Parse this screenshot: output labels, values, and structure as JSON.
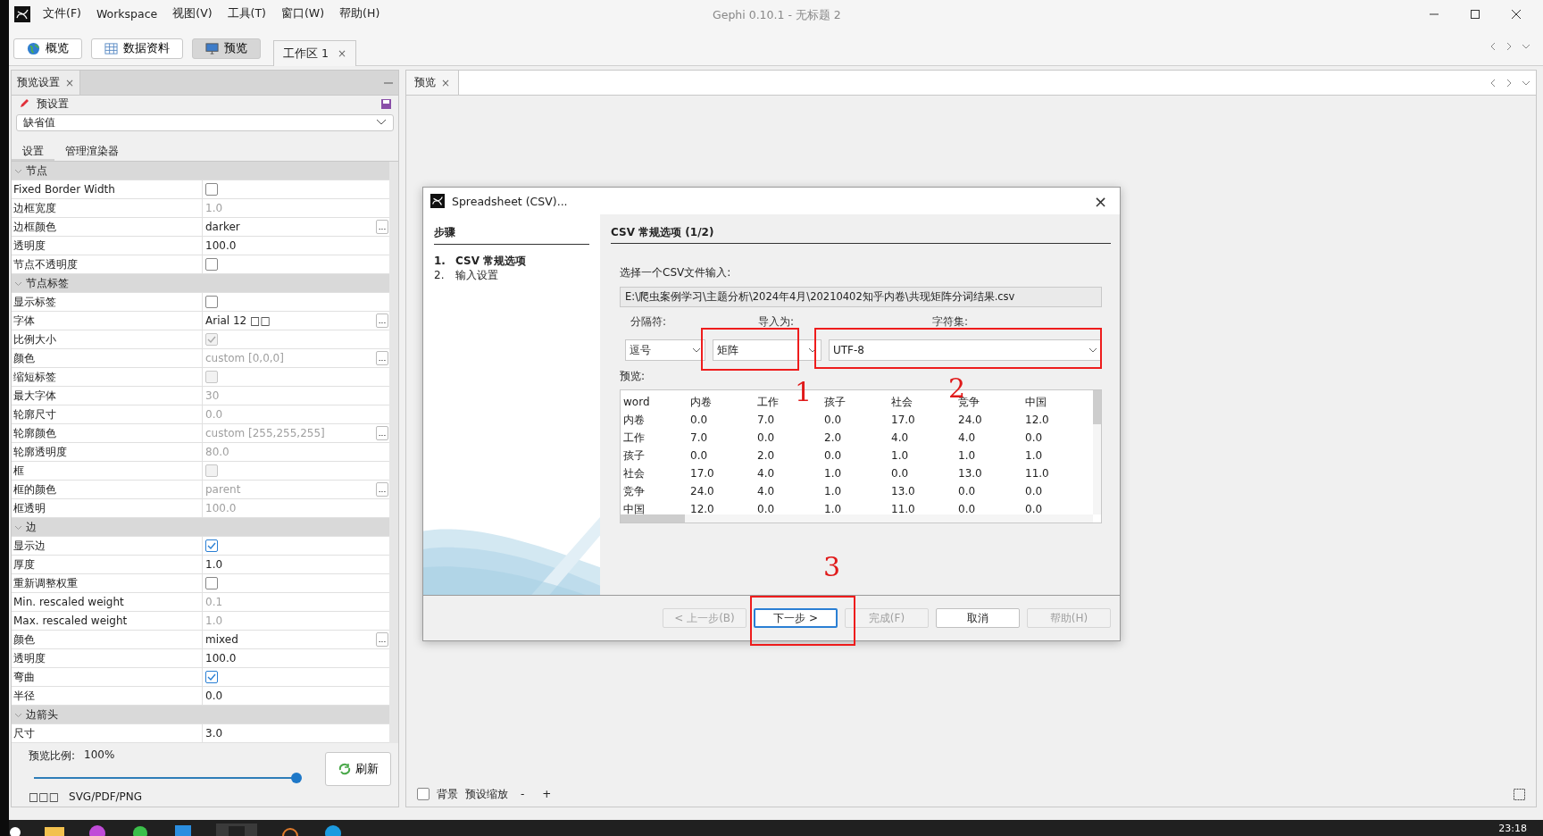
{
  "app": {
    "title": "Gephi 0.10.1 - 无标题 2",
    "menu": [
      "文件(F)",
      "Workspace",
      "视图(V)",
      "工具(T)",
      "窗口(W)",
      "帮助(H)"
    ]
  },
  "perspectives": [
    {
      "label": "概览",
      "selected": false
    },
    {
      "label": "数据资料",
      "selected": false
    },
    {
      "label": "预览",
      "selected": true
    }
  ],
  "workspace_tab": {
    "label": "工作区 1",
    "close": "×"
  },
  "settings_panel": {
    "tab": "预览设置",
    "close": "×",
    "preset_label": "预设置",
    "preset_value": "缺省值",
    "subtabs": [
      {
        "label": "设置",
        "selected": true
      },
      {
        "label": "管理渲染器",
        "selected": false
      }
    ],
    "sections": [
      {
        "label": "节点",
        "expanded": true,
        "rows": [
          {
            "label": "Fixed Border Width",
            "kind": "checkbox",
            "checked": false,
            "disabled": false
          },
          {
            "label": "边框宽度",
            "kind": "text",
            "value": "1.0",
            "disabled": true
          },
          {
            "label": "边框颜色",
            "kind": "text",
            "value": "darker",
            "disabled": false,
            "button": "..."
          },
          {
            "label": "透明度",
            "kind": "text",
            "value": "100.0",
            "disabled": false
          },
          {
            "label": "节点不透明度",
            "kind": "checkbox",
            "checked": false,
            "disabled": false
          }
        ]
      },
      {
        "label": "节点标签",
        "expanded": true,
        "rows": [
          {
            "label": "显示标签",
            "kind": "checkbox",
            "checked": false,
            "disabled": false
          },
          {
            "label": "字体",
            "kind": "text",
            "value": "Arial 12 □□",
            "disabled": false,
            "button": "..."
          },
          {
            "label": "比例大小",
            "kind": "checkbox",
            "checked": true,
            "disabled": true
          },
          {
            "label": "颜色",
            "kind": "text",
            "value": "custom [0,0,0]",
            "disabled": true,
            "button": "..."
          },
          {
            "label": "缩短标签",
            "kind": "checkbox",
            "checked": false,
            "disabled": true
          },
          {
            "label": "最大字体",
            "kind": "text",
            "value": "30",
            "disabled": true
          },
          {
            "label": "轮廓尺寸",
            "kind": "text",
            "value": "0.0",
            "disabled": true
          },
          {
            "label": "轮廓颜色",
            "kind": "text",
            "value": "custom [255,255,255]",
            "disabled": true,
            "button": "..."
          },
          {
            "label": "轮廓透明度",
            "kind": "text",
            "value": "80.0",
            "disabled": true
          },
          {
            "label": "框",
            "kind": "checkbox",
            "checked": false,
            "disabled": true
          },
          {
            "label": "框的颜色",
            "kind": "text",
            "value": "parent",
            "disabled": true,
            "button": "..."
          },
          {
            "label": "框透明",
            "kind": "text",
            "value": "100.0",
            "disabled": true
          }
        ]
      },
      {
        "label": "边",
        "expanded": true,
        "rows": [
          {
            "label": "显示边",
            "kind": "checkbox",
            "checked": true,
            "disabled": false
          },
          {
            "label": "厚度",
            "kind": "text",
            "value": "1.0",
            "disabled": false
          },
          {
            "label": "重新调整权重",
            "kind": "checkbox",
            "checked": false,
            "disabled": false
          },
          {
            "label": "Min. rescaled weight",
            "kind": "text",
            "value": "0.1",
            "disabled": true
          },
          {
            "label": "Max. rescaled weight",
            "kind": "text",
            "value": "1.0",
            "disabled": true
          },
          {
            "label": "颜色",
            "kind": "text",
            "value": "mixed",
            "disabled": false,
            "button": "..."
          },
          {
            "label": "透明度",
            "kind": "text",
            "value": "100.0",
            "disabled": false
          },
          {
            "label": "弯曲",
            "kind": "checkbox",
            "checked": true,
            "disabled": false
          },
          {
            "label": "半径",
            "kind": "text",
            "value": "0.0",
            "disabled": false
          }
        ]
      },
      {
        "label": "边箭头",
        "expanded": true,
        "rows": [
          {
            "label": "尺寸",
            "kind": "text",
            "value": "3.0",
            "disabled": false
          }
        ]
      }
    ],
    "ratio_label": "预览比例:",
    "ratio_value": "100%",
    "zoom_slider": {
      "level": 1.0
    },
    "refresh": "刷新",
    "export_label": "□□□",
    "export_formats": "SVG/PDF/PNG"
  },
  "preview_panel": {
    "tab": "预览",
    "close": "×",
    "background_label": "背景",
    "background_checked": false,
    "zoom_label": "预设缩放",
    "zoom_out": "-",
    "zoom_in": "+"
  },
  "dialog": {
    "title": "Spreadsheet (CSV)...",
    "close": "×",
    "steps_heading": "步骤",
    "steps": [
      {
        "number": "1.",
        "label": "CSV 常规选项",
        "selected": true
      },
      {
        "number": "2.",
        "label": "输入设置",
        "selected": false
      }
    ],
    "heading": "CSV 常规选项 (1/2)",
    "file_prompt": "选择一个CSV文件输入:",
    "file_path": "E:\\爬虫案例学习\\主题分析\\2024年4月\\20210402知乎内卷\\共现矩阵分词结果.csv",
    "delimiter_label": "分隔符:",
    "delimiter_value": "逗号",
    "import_label": "导入为:",
    "import_value": "矩阵",
    "charset_label": "字符集:",
    "charset_value": "UTF-8",
    "preview_label": "预览:",
    "columns": [
      "word",
      "内卷",
      "工作",
      "孩子",
      "社会",
      "竞争",
      "中国"
    ],
    "rows": [
      [
        "内卷",
        "0.0",
        "7.0",
        "0.0",
        "17.0",
        "24.0",
        "12.0"
      ],
      [
        "工作",
        "7.0",
        "0.0",
        "2.0",
        "4.0",
        "4.0",
        "0.0"
      ],
      [
        "孩子",
        "0.0",
        "2.0",
        "0.0",
        "1.0",
        "1.0",
        "1.0"
      ],
      [
        "社会",
        "17.0",
        "4.0",
        "1.0",
        "0.0",
        "13.0",
        "11.0"
      ],
      [
        "竞争",
        "24.0",
        "4.0",
        "1.0",
        "13.0",
        "0.0",
        "0.0"
      ],
      [
        "中国",
        "12.0",
        "0.0",
        "1.0",
        "11.0",
        "0.0",
        "0.0"
      ]
    ],
    "buttons": [
      {
        "label": "< 上一步(B)",
        "disabled": true,
        "default": false
      },
      {
        "label": "下一步 >",
        "disabled": false,
        "default": true
      },
      {
        "label": "完成(F)",
        "disabled": true,
        "default": false
      },
      {
        "label": "取消",
        "disabled": false,
        "default": false
      },
      {
        "label": "帮助(H)",
        "disabled": true,
        "default": false
      }
    ]
  },
  "annotations": [
    {
      "label": "1"
    },
    {
      "label": "2"
    },
    {
      "label": "3"
    }
  ],
  "taskbar": {
    "time": "23:18"
  }
}
